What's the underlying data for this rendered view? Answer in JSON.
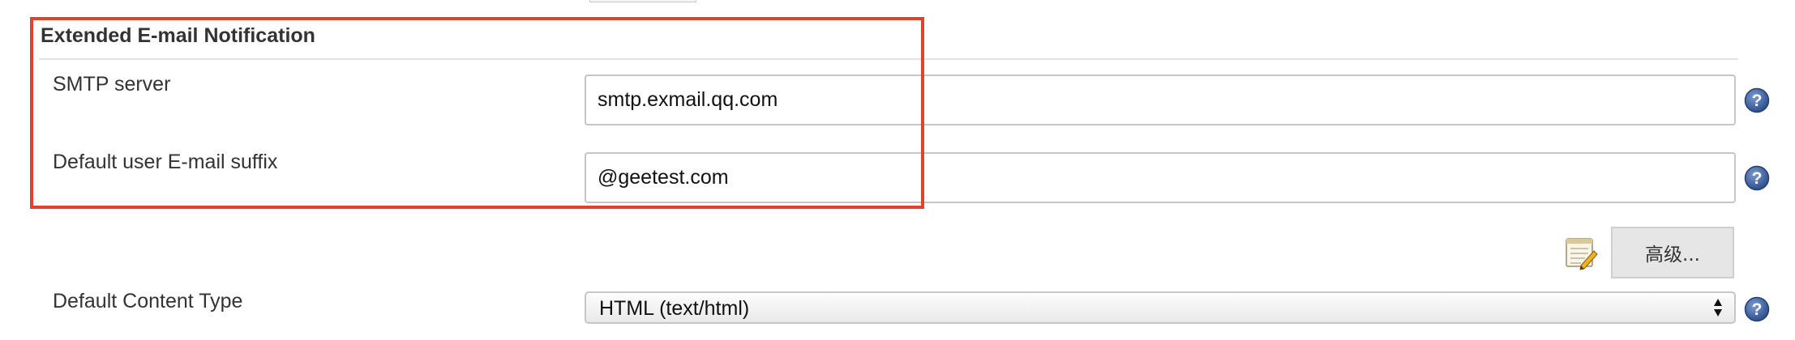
{
  "section": {
    "title": "Extended E-mail Notification"
  },
  "smtp": {
    "label": "SMTP server",
    "value": "smtp.exmail.qq.com"
  },
  "email_suffix": {
    "label": "Default user E-mail suffix",
    "value": "@geetest.com"
  },
  "advanced": {
    "button_label": "高级..."
  },
  "content_type": {
    "label": "Default Content Type",
    "selected": "HTML (text/html)"
  },
  "icons": {
    "help": "help-icon",
    "notepad": "notepad-icon",
    "select_arrows": "chevron-up-down-icon"
  },
  "colors": {
    "highlight_border": "#e2412b",
    "help_icon": "#3a5d98",
    "button_background": "#e6e6e6"
  }
}
